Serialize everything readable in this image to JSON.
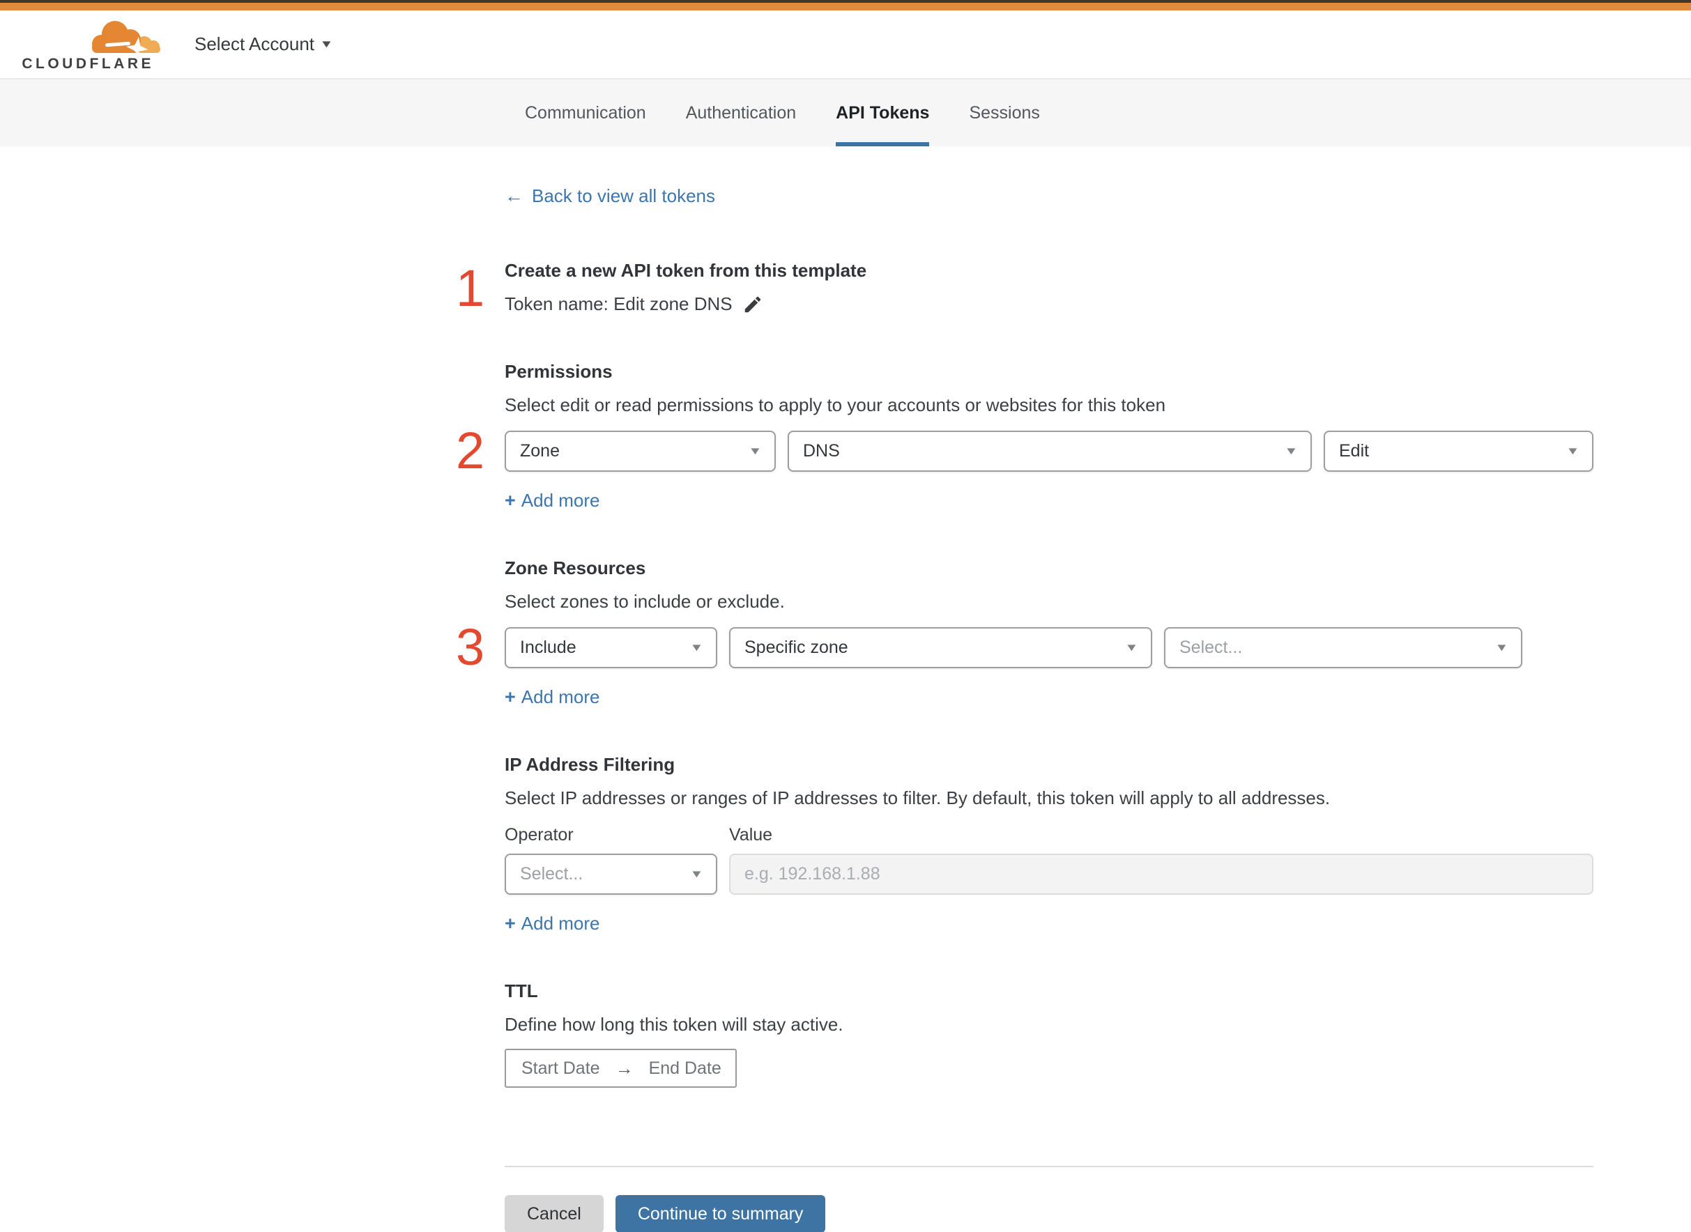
{
  "colors": {
    "accent_orange": "#E28A39",
    "link_blue": "#3C76AC",
    "button_blue": "#3E74A4",
    "step_number_red": "#E2492E",
    "tab_underline_blue": "#3E74A4"
  },
  "header": {
    "logo_text": "CLOUDFLARE",
    "account_selector_label": "Select Account"
  },
  "tabs": [
    {
      "label": "Communication"
    },
    {
      "label": "Authentication"
    },
    {
      "label": "API Tokens"
    },
    {
      "label": "Sessions"
    }
  ],
  "back": {
    "arrow_icon": "←",
    "label": "Back to view all tokens"
  },
  "step1": {
    "number": "1",
    "heading": "Create a new API token from this template",
    "token_name_line": "Token name: Edit zone DNS"
  },
  "permissions": {
    "number": "2",
    "heading": "Permissions",
    "description": "Select edit or read permissions to apply to your accounts or websites for this token",
    "scope_value": "Zone",
    "category_value": "DNS",
    "access_value": "Edit",
    "add_more_label": "Add more"
  },
  "zone_resources": {
    "number": "3",
    "heading": "Zone Resources",
    "description": "Select zones to include or exclude.",
    "operator_value": "Include",
    "type_value": "Specific zone",
    "zone_placeholder": "Select...",
    "add_more_label": "Add more"
  },
  "ip_filtering": {
    "heading": "IP Address Filtering",
    "description": "Select IP addresses or ranges of IP addresses to filter. By default, this token will apply to all addresses.",
    "operator_label": "Operator",
    "value_label": "Value",
    "operator_placeholder": "Select...",
    "value_placeholder": "e.g. 192.168.1.88",
    "add_more_label": "Add more"
  },
  "ttl": {
    "heading": "TTL",
    "description": "Define how long this token will stay active.",
    "start_date_label": "Start Date",
    "arrow_icon": "→",
    "end_date_label": "End Date"
  },
  "footer": {
    "cancel_label": "Cancel",
    "continue_label": "Continue to summary"
  },
  "ui": {
    "plus_icon": "+",
    "caret_icon": "▼"
  }
}
